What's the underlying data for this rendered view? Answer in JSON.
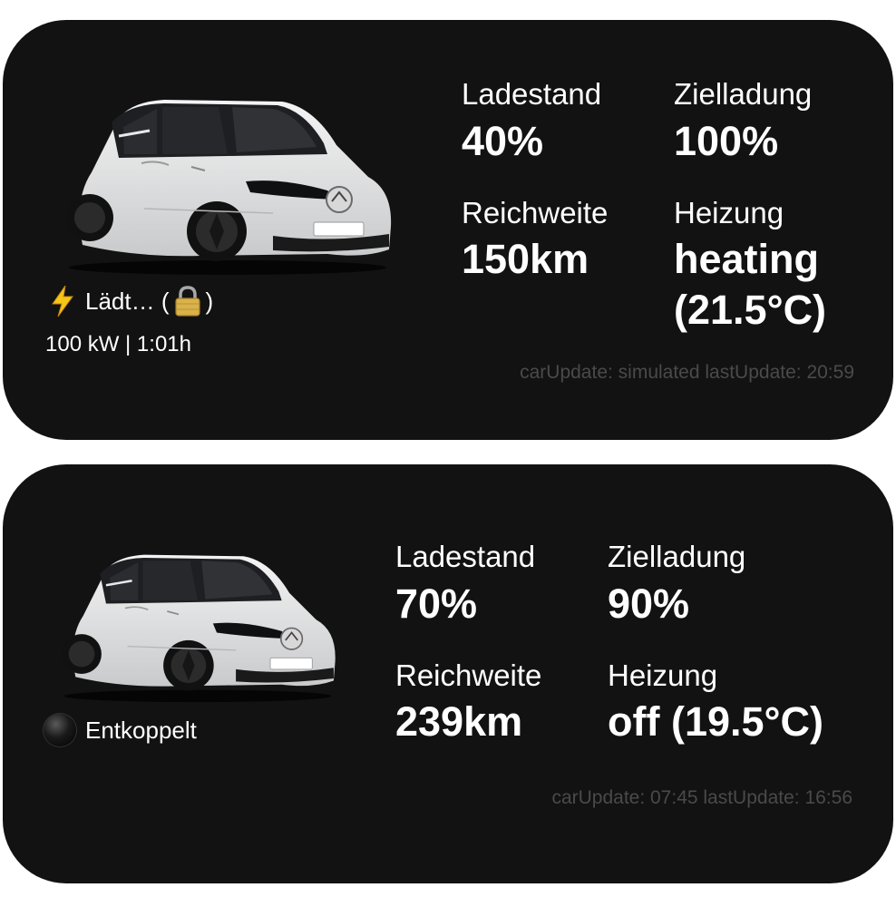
{
  "widgets": [
    {
      "status_text": "Lädt… (",
      "status_close": ")",
      "status_icon": "lightning-bolt-icon",
      "lock_icon": "lock-icon",
      "subline": "100 kW | 1:01h",
      "metrics": {
        "ladestand_label": "Ladestand",
        "ladestand_value": "40%",
        "zielladung_label": "Zielladung",
        "zielladung_value": "100%",
        "reichweite_label": "Reichweite",
        "reichweite_value": "150km",
        "heizung_label": "Heizung",
        "heizung_value_line1": "heating",
        "heizung_value_line2": "(21.5°C)"
      },
      "footer": "carUpdate: simulated lastUpdate: 20:59"
    },
    {
      "status_text": "Entkoppelt",
      "status_icon": "black-circle-icon",
      "metrics": {
        "ladestand_label": "Ladestand",
        "ladestand_value": "70%",
        "zielladung_label": "Zielladung",
        "zielladung_value": "90%",
        "reichweite_label": "Reichweite",
        "reichweite_value": "239km",
        "heizung_label": "Heizung",
        "heizung_value": "off (19.5°C)"
      },
      "footer": "carUpdate: 07:45 lastUpdate: 16:56"
    }
  ],
  "colors": {
    "widget_bg": "#121212",
    "text": "#ffffff",
    "footer_text": "#4a4a4a",
    "bolt": "#f5c518",
    "lock": "#d9b24a"
  }
}
